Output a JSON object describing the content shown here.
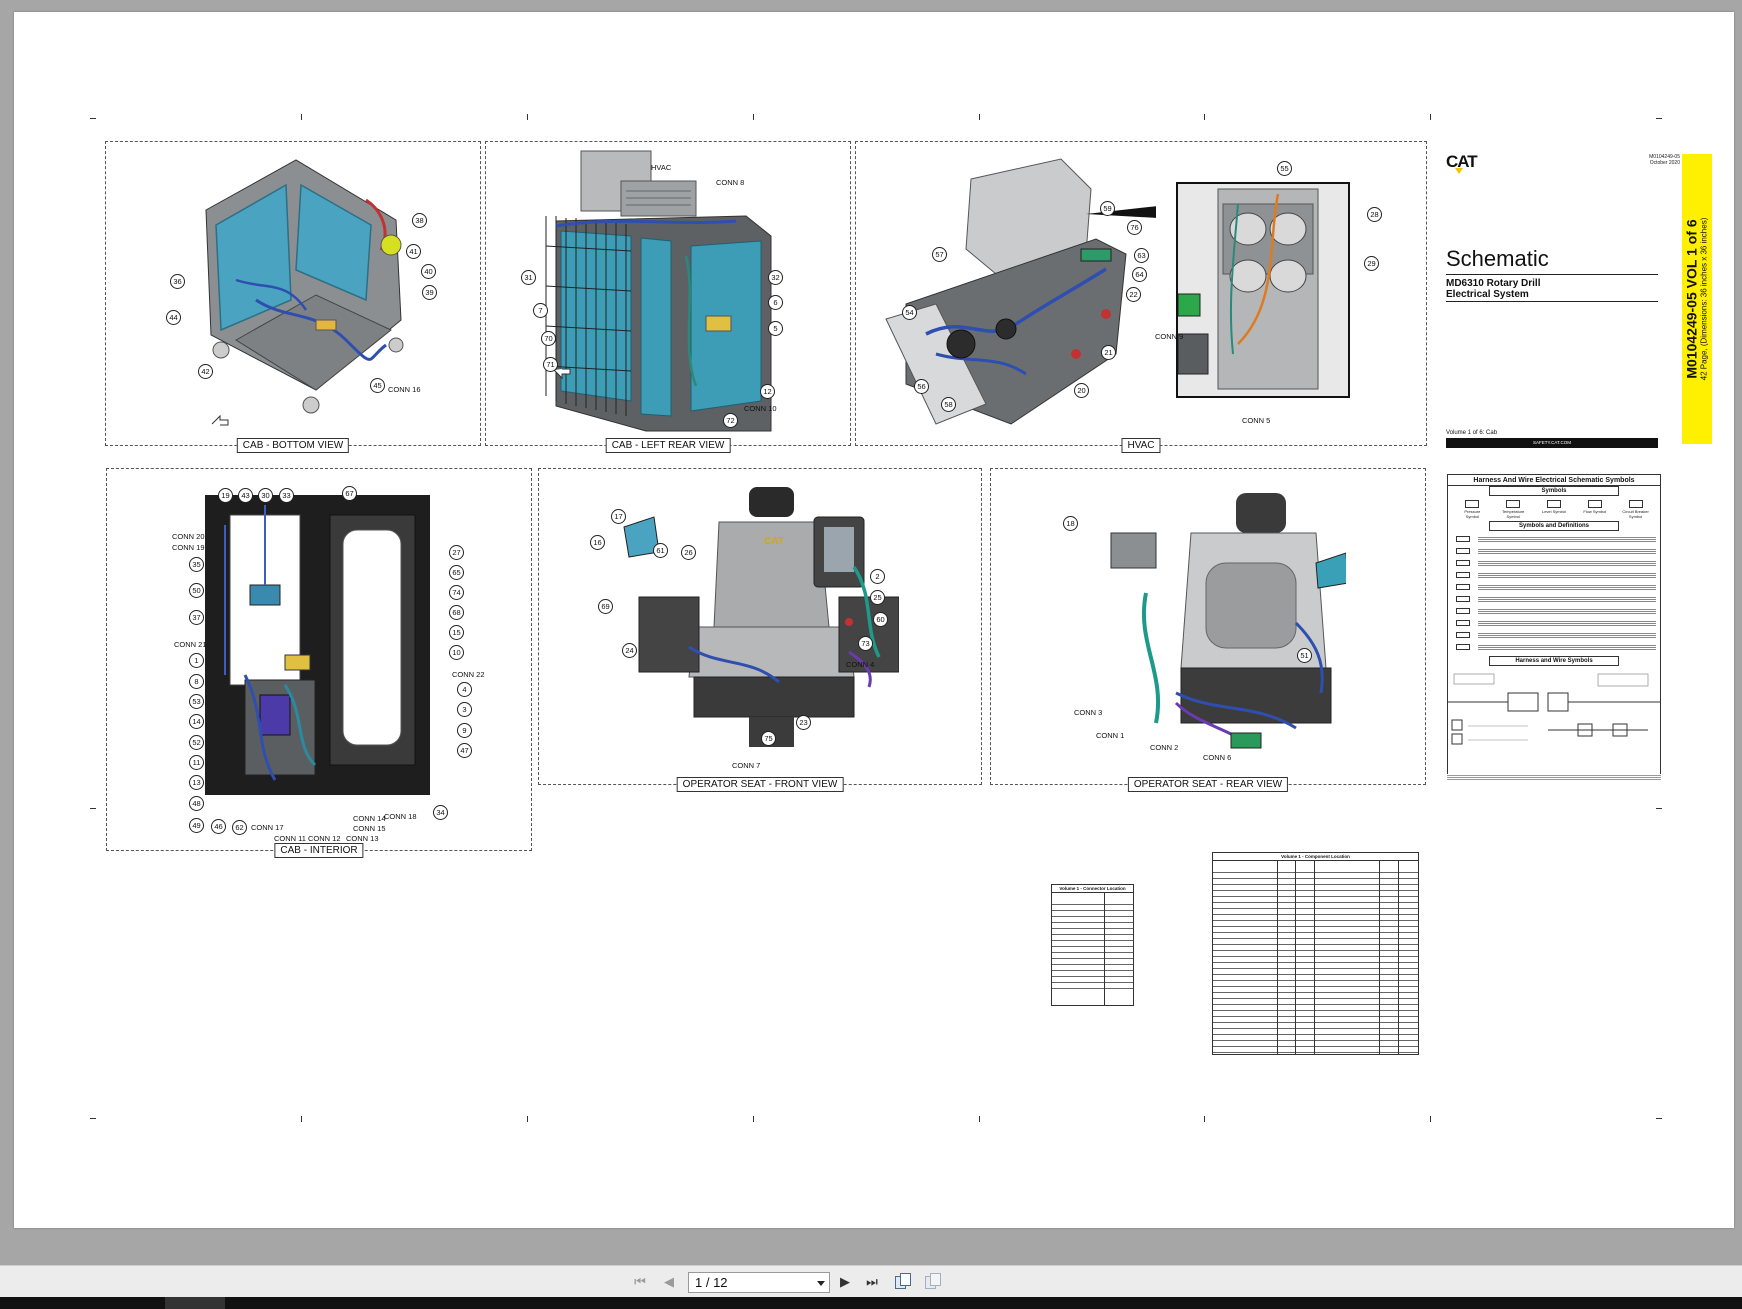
{
  "document": {
    "logo_text": "CAT",
    "doc_no_small": "M0104249-05",
    "doc_date_small": "October 2020",
    "title": "Schematic",
    "subtitle_line1": "MD6310 Rotary Drill",
    "subtitle_line2": "Electrical System",
    "volume_label": "Volume 1 of 6: Cab",
    "website": "SAFETY.CAT.COM",
    "vertical_title": "M0104249-05 VOL 1 of 6",
    "vertical_subtitle": "42 Page, (Dimensions: 36 inches x 36 inches)"
  },
  "panels": [
    {
      "id": "cab-bottom-view",
      "label": "CAB - BOTTOM VIEW"
    },
    {
      "id": "cab-left-rear-view",
      "label": "CAB - LEFT REAR VIEW"
    },
    {
      "id": "hvac",
      "label": "HVAC"
    },
    {
      "id": "cab-interior",
      "label": "CAB - INTERIOR"
    },
    {
      "id": "operator-seat-front-view",
      "label": "OPERATOR SEAT - FRONT VIEW"
    },
    {
      "id": "operator-seat-rear-view",
      "label": "OPERATOR SEAT - REAR VIEW"
    }
  ],
  "callouts": {
    "bottom": [
      "38",
      "41",
      "40",
      "39",
      "36",
      "44",
      "42",
      "45"
    ],
    "bottom_conn": [
      "CONN 16"
    ],
    "rear": [
      "31",
      "7",
      "70",
      "71",
      "32",
      "6",
      "5",
      "12",
      "72"
    ],
    "rear_conn": [
      "HVAC",
      "CONN 8",
      "CONN 10"
    ],
    "hvac": [
      "55",
      "28",
      "29",
      "59",
      "76",
      "63",
      "64",
      "22",
      "57",
      "54",
      "56",
      "58",
      "21",
      "20"
    ],
    "hvac_conn": [
      "CONN 9",
      "CONN 5"
    ],
    "interior": [
      "19",
      "43",
      "30",
      "33",
      "67",
      "35",
      "50",
      "37",
      "1",
      "8",
      "53",
      "14",
      "52",
      "11",
      "13",
      "48",
      "49",
      "46",
      "62",
      "27",
      "65",
      "74",
      "68",
      "15",
      "10",
      "4",
      "3",
      "9",
      "47",
      "34"
    ],
    "interior_conn": [
      "CONN 20",
      "CONN 19",
      "CONN 21",
      "CONN 22",
      "CONN 18",
      "CONN 14",
      "CONN 15",
      "CONN 13",
      "CONN 17",
      "CONN 11",
      "CONN 12"
    ],
    "front": [
      "17",
      "16",
      "61",
      "26",
      "69",
      "24",
      "2",
      "25",
      "60",
      "73",
      "75",
      "23"
    ],
    "front_conn": [
      "CONN 4",
      "CONN 7"
    ],
    "seatrear": [
      "18",
      "51"
    ],
    "seatrear_conn": [
      "CONN 3",
      "CONN 1",
      "CONN 2",
      "CONN 6"
    ]
  },
  "legend": {
    "title": "Harness And Wire Electrical Schematic Symbols",
    "section1": "Symbols",
    "symbols": [
      "Pressure Symbol",
      "Temperature Symbol",
      "Level Symbol",
      "Flow Symbol",
      "Circuit Breaker Symbol"
    ],
    "section2": "Symbols and Definitions",
    "section3": "Harness and Wire Symbols"
  },
  "tables": {
    "connector_title": "Volume 1 - Connector Location",
    "component_title": "Volume 1 - Component Location"
  },
  "toolbar": {
    "page_indicator": "1 / 12"
  }
}
